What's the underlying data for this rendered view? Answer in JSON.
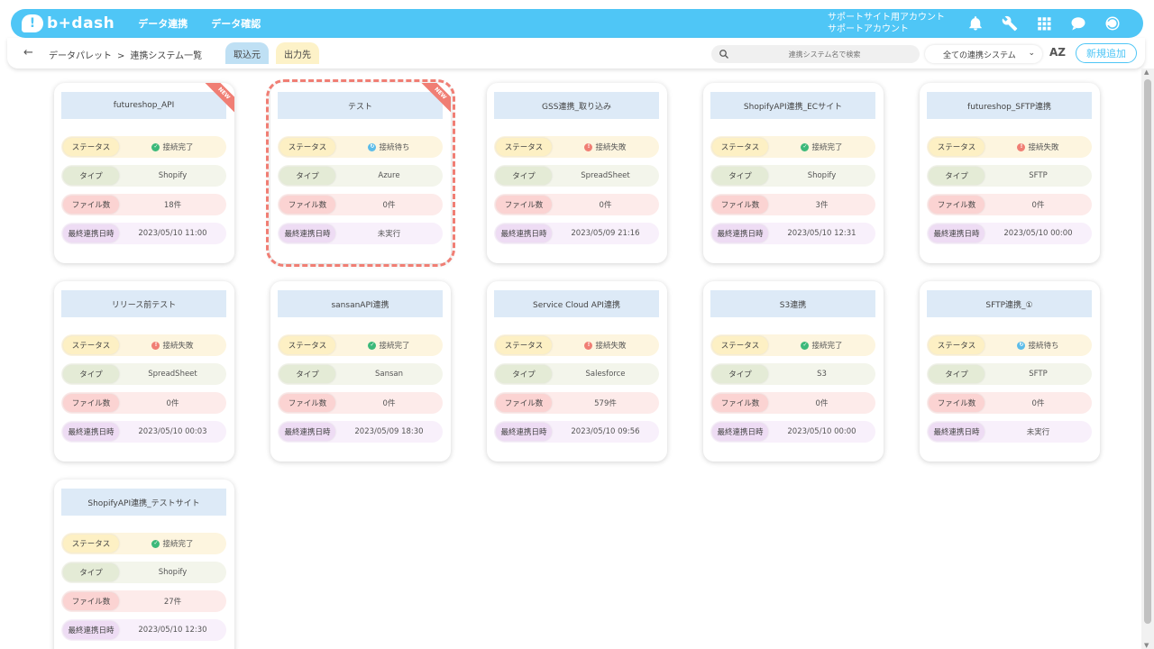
{
  "header": {
    "logo_mark": "!",
    "logo_text": "b+dash",
    "nav": [
      "データ連携",
      "データ確認"
    ],
    "account_line1": "サポートサイト用アカウント",
    "account_line2": "サポートアカウント"
  },
  "subbar": {
    "back": "←",
    "breadcrumb_root": "データパレット",
    "breadcrumb_sep": ">",
    "breadcrumb_current": "連携システム一覧",
    "tab_import": "取込元",
    "tab_output": "出力先",
    "search_placeholder": "連携システム名で検索",
    "select_value": "全ての連携システム",
    "sort_label": "AZ",
    "add_button": "新規追加"
  },
  "labels": {
    "status": "ステータス",
    "type": "タイプ",
    "files": "ファイル数",
    "last": "最終連携日時"
  },
  "ribbon_text": "NEW",
  "cards": [
    {
      "title": "futureshop_API",
      "status": "接続完了",
      "status_kind": "ok",
      "type": "Shopify",
      "files": "18件",
      "last": "2023/05/10 11:00",
      "is_new": true
    },
    {
      "title": "テスト",
      "status": "接続待ち",
      "status_kind": "wait",
      "type": "Azure",
      "files": "0件",
      "last": "未実行",
      "is_new": true
    },
    {
      "title": "GSS連携_取り込み",
      "status": "接続失敗",
      "status_kind": "err",
      "type": "SpreadSheet",
      "files": "0件",
      "last": "2023/05/09 21:16",
      "is_new": false
    },
    {
      "title": "ShopifyAPI連携_ECサイト",
      "status": "接続完了",
      "status_kind": "ok",
      "type": "Shopify",
      "files": "3件",
      "last": "2023/05/10 12:31",
      "is_new": false
    },
    {
      "title": "futureshop_SFTP連携",
      "status": "接続失敗",
      "status_kind": "err",
      "type": "SFTP",
      "files": "0件",
      "last": "2023/05/10 00:00",
      "is_new": false
    },
    {
      "title": "リリース前テスト",
      "status": "接続失敗",
      "status_kind": "err",
      "type": "SpreadSheet",
      "files": "0件",
      "last": "2023/05/10 00:03",
      "is_new": false
    },
    {
      "title": "sansanAPI連携",
      "status": "接続完了",
      "status_kind": "ok",
      "type": "Sansan",
      "files": "0件",
      "last": "2023/05/09 18:30",
      "is_new": false
    },
    {
      "title": "Service Cloud API連携",
      "status": "接続失敗",
      "status_kind": "err",
      "type": "Salesforce",
      "files": "579件",
      "last": "2023/05/10 09:56",
      "is_new": false
    },
    {
      "title": "S3連携",
      "status": "接続完了",
      "status_kind": "ok",
      "type": "S3",
      "files": "0件",
      "last": "2023/05/10 00:00",
      "is_new": false
    },
    {
      "title": "SFTP連携_①",
      "status": "接続待ち",
      "status_kind": "wait",
      "type": "SFTP",
      "files": "0件",
      "last": "未実行",
      "is_new": false
    },
    {
      "title": "ShopifyAPI連携_テストサイト",
      "status": "接続完了",
      "status_kind": "ok",
      "type": "Shopify",
      "files": "27件",
      "last": "2023/05/10 12:30",
      "is_new": false
    }
  ],
  "colors": {
    "brand": "#4fc6f6",
    "ok": "#3cb97a",
    "err": "#f07e74",
    "wait": "#5cbce9",
    "highlight": "#f07e74"
  }
}
